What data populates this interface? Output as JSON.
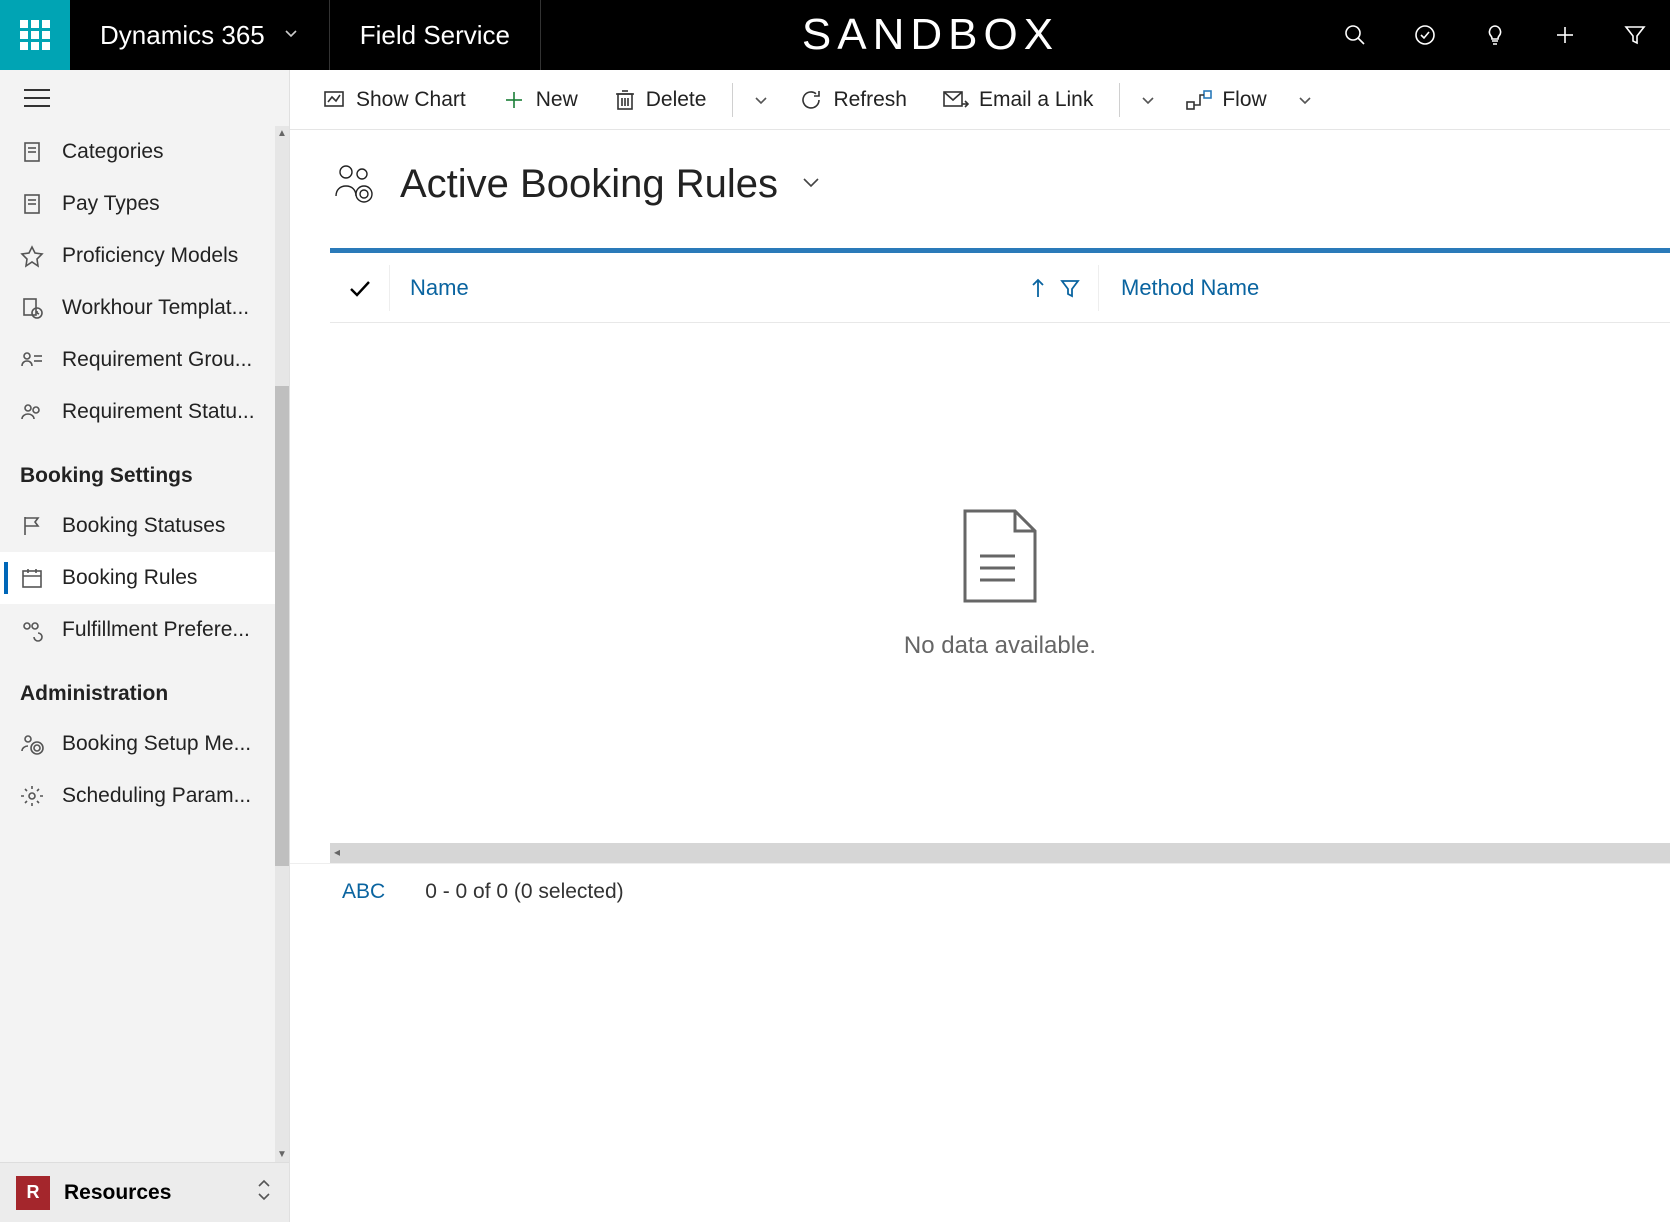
{
  "topbar": {
    "brand": "Dynamics 365",
    "module": "Field Service",
    "env": "SANDBOX"
  },
  "commands": {
    "show_chart": "Show Chart",
    "new": "New",
    "delete": "Delete",
    "refresh": "Refresh",
    "email_link": "Email a Link",
    "flow": "Flow"
  },
  "sidebar": {
    "items_top": [
      {
        "label": "Categories"
      },
      {
        "label": "Pay Types"
      },
      {
        "label": "Proficiency Models"
      },
      {
        "label": "Workhour Templat..."
      },
      {
        "label": "Requirement Grou..."
      },
      {
        "label": "Requirement Statu..."
      }
    ],
    "group1": "Booking Settings",
    "items_booking": [
      {
        "label": "Booking Statuses"
      },
      {
        "label": "Booking Rules"
      },
      {
        "label": "Fulfillment Prefere..."
      }
    ],
    "group2": "Administration",
    "items_admin": [
      {
        "label": "Booking Setup Me..."
      },
      {
        "label": "Scheduling Param..."
      }
    ],
    "area_badge": "R",
    "area_label": "Resources"
  },
  "view": {
    "title": "Active Booking Rules",
    "columns": {
      "name": "Name",
      "method": "Method Name"
    },
    "empty": "No data available."
  },
  "footer": {
    "abc": "ABC",
    "paging": "0 - 0 of 0 (0 selected)"
  }
}
